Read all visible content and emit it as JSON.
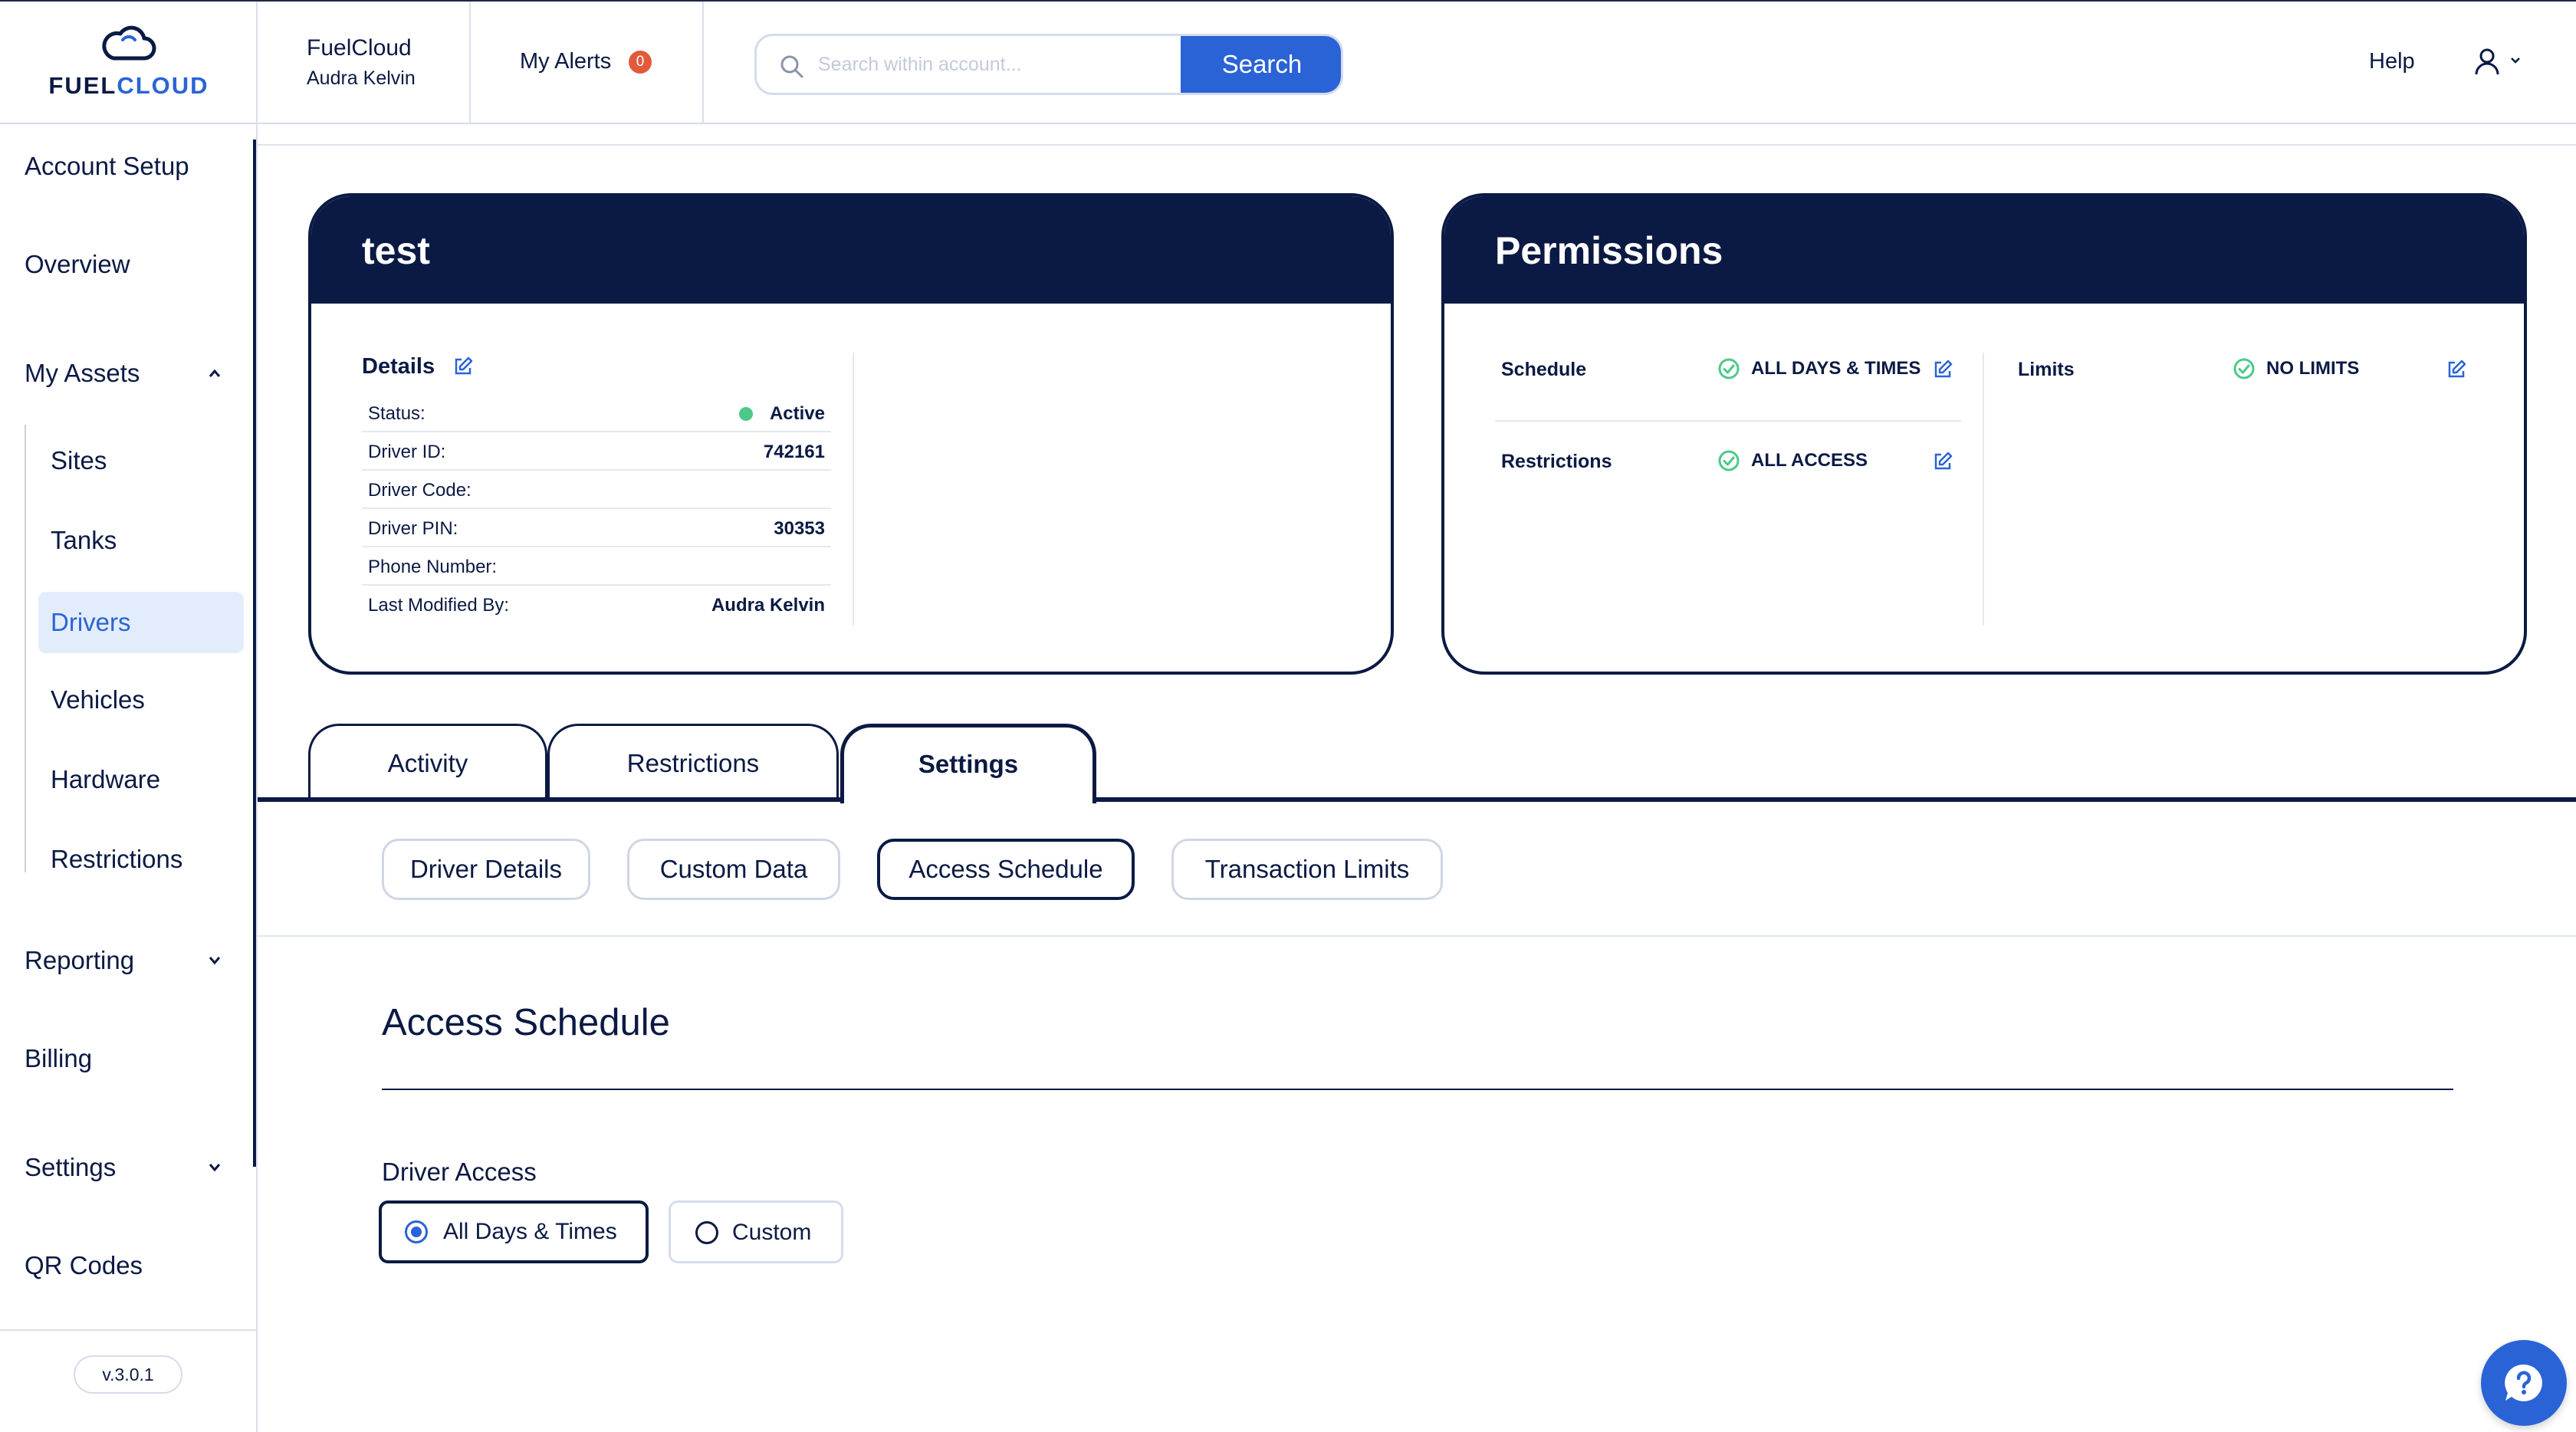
{
  "header": {
    "logo": {
      "part1": "FUEL",
      "part2": "CLOUD"
    },
    "account_name": "FuelCloud",
    "account_user": "Audra Kelvin",
    "alerts_label": "My Alerts",
    "alerts_count": "0",
    "search_placeholder": "Search within account...",
    "search_button": "Search",
    "help_label": "Help",
    "colors": {
      "brand_navy": "#0b1a44",
      "brand_blue": "#2a63d6",
      "alert_badge": "#e25a3b"
    }
  },
  "sidebar": {
    "items": [
      {
        "label": "Account Setup"
      },
      {
        "label": "Overview"
      },
      {
        "label": "My Assets",
        "expanded": true,
        "icon": "chevron-up-icon"
      },
      {
        "label": "Reporting",
        "icon": "chevron-down-icon"
      },
      {
        "label": "Billing"
      },
      {
        "label": "Settings",
        "icon": "chevron-down-icon"
      },
      {
        "label": "QR Codes"
      }
    ],
    "sub_items": [
      {
        "label": "Sites"
      },
      {
        "label": "Tanks"
      },
      {
        "label": "Drivers",
        "active": true
      },
      {
        "label": "Vehicles"
      },
      {
        "label": "Hardware"
      },
      {
        "label": "Restrictions"
      }
    ],
    "version": "v.3.0.1"
  },
  "driver_card": {
    "title": "test",
    "details_title": "Details",
    "rows": [
      {
        "label": "Status:",
        "value": "Active"
      },
      {
        "label": "Driver ID:",
        "value": "742161"
      },
      {
        "label": "Driver Code:",
        "value": ""
      },
      {
        "label": "Driver PIN:",
        "value": "30353"
      },
      {
        "label": "Phone Number:",
        "value": ""
      },
      {
        "label": "Last Modified By:",
        "value": "Audra Kelvin"
      }
    ],
    "status_color": "#4cc98a"
  },
  "permissions_card": {
    "title": "Permissions",
    "schedule_label": "Schedule",
    "schedule_value": "ALL DAYS & TIMES",
    "restrictions_label": "Restrictions",
    "restrictions_value": "ALL ACCESS",
    "limits_label": "Limits",
    "limits_value": "NO LIMITS"
  },
  "tabs": [
    {
      "label": "Activity"
    },
    {
      "label": "Restrictions"
    },
    {
      "label": "Settings",
      "active": true
    }
  ],
  "subtabs": [
    {
      "label": "Driver Details"
    },
    {
      "label": "Custom Data"
    },
    {
      "label": "Access Schedule",
      "active": true
    },
    {
      "label": "Transaction Limits"
    }
  ],
  "access_schedule": {
    "title": "Access Schedule",
    "driver_access_label": "Driver Access",
    "options": [
      {
        "label": "All Days & Times",
        "selected": true
      },
      {
        "label": "Custom",
        "selected": false
      }
    ]
  }
}
